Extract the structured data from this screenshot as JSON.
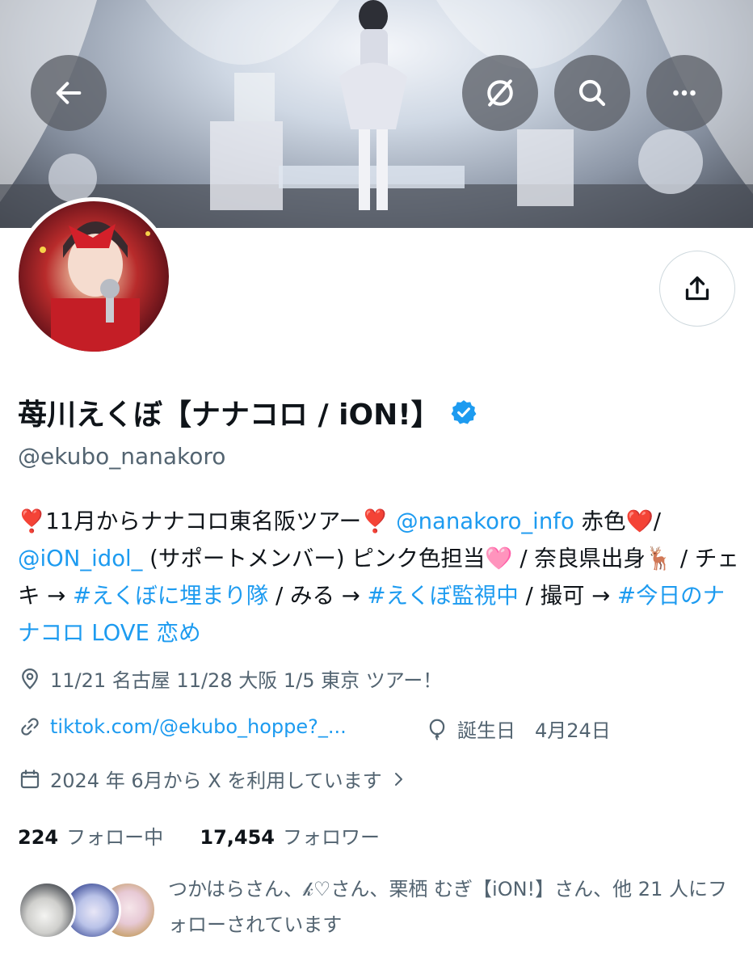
{
  "header": {
    "back_icon": "arrow-left-icon",
    "actions": [
      "grok-icon",
      "search-icon",
      "more-icon"
    ]
  },
  "profile": {
    "name": "苺川えくぼ【ナナコロ / iON!】",
    "handle": "@ekubo_nanakoro",
    "verified": true,
    "bio": {
      "p1": "❣️11月からナナコロ東名阪ツアー❣️ ",
      "m1": "@nanakoro_info",
      "p2": " 赤色❤️/ ",
      "m2": "@iON_idol_",
      "p3": " (サポートメンバー) ピンク色担当🩷 / 奈良県出身🦌 / チェキ → ",
      "h1": "#えくぼに埋まり隊",
      "p4": " / みる → ",
      "h2": "#えくぼ監視中",
      "p5": " / 撮可 → ",
      "h3": "#今日のナナコロ LOVE 恋め"
    },
    "location": "11/21 名古屋 11/28 大阪 1/5 東京 ツアー！",
    "website": "tiktok.com/@ekubo_hoppe?_...",
    "birthday": "誕生日　4月24日",
    "joined": "2024 年 6月から X を利用しています",
    "following_count": "224",
    "following_label": "フォロー中",
    "followers_count": "17,454",
    "followers_label": "フォロワー",
    "followed_by_text": "つかはらさん、𝓀♡さん、栗栖 むぎ【iON!】さん、他 21 人にフォローされています"
  },
  "colors": {
    "accent": "#1d9bf0",
    "text": "#0f1419",
    "secondary": "#536471"
  }
}
